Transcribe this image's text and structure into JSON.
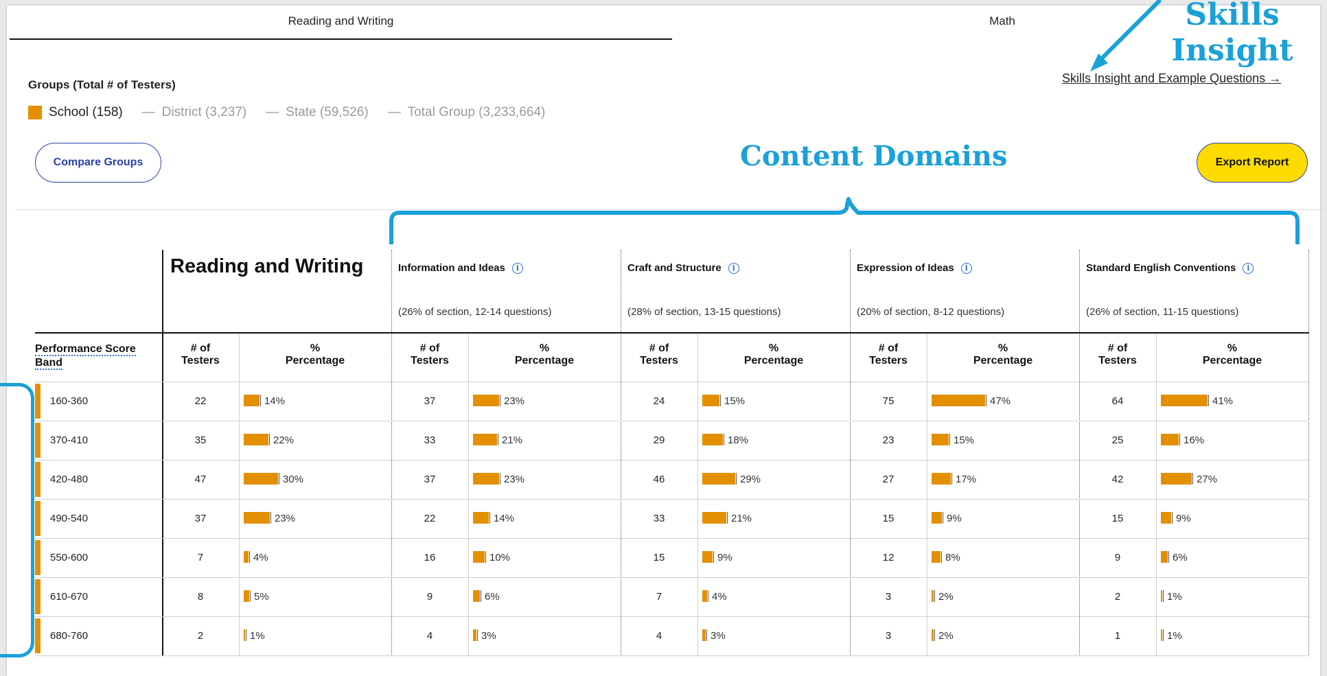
{
  "tabs": [
    {
      "label": "Reading and Writing",
      "active": true
    },
    {
      "label": "Math",
      "active": false
    }
  ],
  "groups": {
    "title": "Groups (Total # of Testers)",
    "items": [
      {
        "label": "School (158)",
        "active": true
      },
      {
        "label": "District (3,237)",
        "active": false
      },
      {
        "label": "State (59,526)",
        "active": false
      },
      {
        "label": "Total Group (3,233,664)",
        "active": false
      }
    ]
  },
  "buttons": {
    "compare": "Compare Groups",
    "export": "Export Report"
  },
  "skills_link": "Skills Insight and Example Questions →",
  "annotations": {
    "skills_line1": "Skills",
    "skills_line2": "Insight",
    "content_domains": "Content Domains"
  },
  "section_title": "Reading and Writing",
  "domains": [
    {
      "title": "Information and Ideas",
      "sub": "(26% of section, 12-14 questions)"
    },
    {
      "title": "Craft and Structure",
      "sub": "(28% of section, 13-15 questions)"
    },
    {
      "title": "Expression of Ideas",
      "sub": "(20% of section, 8-12 questions)"
    },
    {
      "title": "Standard English Conventions",
      "sub": "(26% of section, 11-15 questions)"
    }
  ],
  "headers": {
    "band_line1": "Performance Score",
    "band_line2": "Band",
    "testers_line1": "# of",
    "testers_line2": "Testers",
    "pct_line1": "%",
    "pct_line2": "Percentage"
  },
  "bands": [
    "160-360",
    "370-410",
    "420-480",
    "490-540",
    "550-600",
    "610-670",
    "680-760"
  ],
  "columns": [
    {
      "counts": [
        22,
        35,
        47,
        37,
        7,
        8,
        2
      ],
      "pcts": [
        14,
        22,
        30,
        23,
        4,
        5,
        1
      ]
    },
    {
      "counts": [
        37,
        33,
        37,
        22,
        16,
        9,
        4
      ],
      "pcts": [
        23,
        21,
        23,
        14,
        10,
        6,
        3
      ]
    },
    {
      "counts": [
        24,
        29,
        46,
        33,
        15,
        7,
        4
      ],
      "pcts": [
        15,
        18,
        29,
        21,
        9,
        4,
        3
      ]
    },
    {
      "counts": [
        75,
        23,
        27,
        15,
        12,
        3,
        3
      ],
      "pcts": [
        47,
        15,
        17,
        9,
        8,
        2,
        2
      ]
    },
    {
      "counts": [
        64,
        25,
        42,
        15,
        9,
        2,
        1
      ],
      "pcts": [
        41,
        16,
        27,
        9,
        6,
        1,
        1
      ]
    }
  ],
  "colors": {
    "bar": "#e39000",
    "accent": "#1aa1d8",
    "export_bg": "#fedb00",
    "link_blue": "#283fa8"
  },
  "icons": {
    "info": "info-icon",
    "arrow": "arrow-icon"
  }
}
